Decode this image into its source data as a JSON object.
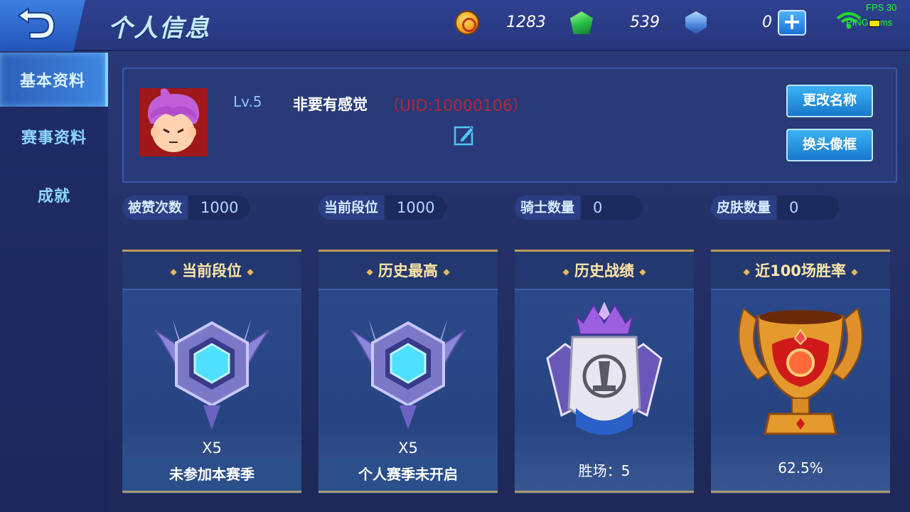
{
  "header": {
    "title": "个人信息",
    "gold": "1283",
    "gems": "539",
    "tokens": "0",
    "fps_text": "FPS 30",
    "ping_text": "PING",
    "ping_unit": "ms"
  },
  "sidebar": {
    "items": [
      {
        "label": "基本资料",
        "active": true
      },
      {
        "label": "赛事资料",
        "active": false
      },
      {
        "label": "成就",
        "active": false
      }
    ]
  },
  "profile": {
    "level": "Lv.5",
    "name": "非要有感觉",
    "uid": "（UID:10000106）",
    "rename_button": "更改名称",
    "frame_button": "换头像框"
  },
  "stats": [
    {
      "label": "被赞次数",
      "value": "1000"
    },
    {
      "label": "当前段位",
      "value": "1000"
    },
    {
      "label": "骑士数量",
      "value": "0"
    },
    {
      "label": "皮肤数量",
      "value": "0"
    }
  ],
  "cards": [
    {
      "title": "当前段位",
      "count": "X5",
      "footer": "未参加本赛季"
    },
    {
      "title": "历史最高",
      "count": "X5",
      "footer": "个人赛季未开启"
    },
    {
      "title": "历史战绩",
      "value": "胜场：5"
    },
    {
      "title": "近100场胜率",
      "value": "62.5%"
    }
  ],
  "colors": {
    "accent_blue": "#3bb2f5",
    "uid_red": "#b2263a",
    "card_title_gold": "#ffe7a8",
    "sidebar_text": "#8fd7ff"
  },
  "icons": {
    "back": "back-arrow-icon",
    "gold": "gold-coin-icon",
    "gem": "green-gem-icon",
    "token": "badge-token-icon",
    "add": "plus-icon",
    "wifi": "wifi-icon",
    "edit": "edit-icon"
  }
}
